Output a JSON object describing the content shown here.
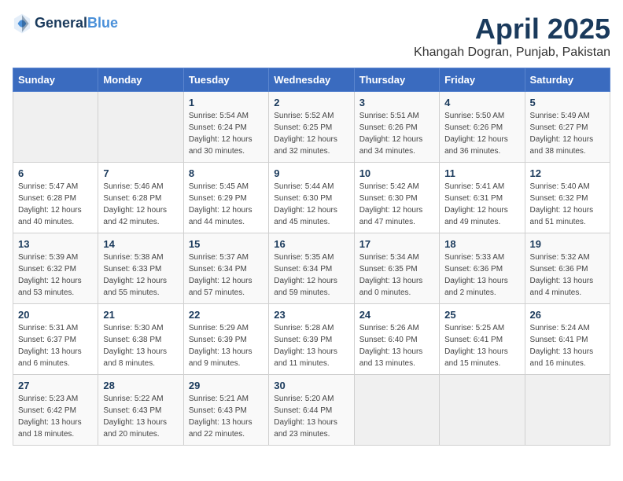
{
  "header": {
    "logo_line1": "General",
    "logo_line2": "Blue",
    "title": "April 2025",
    "subtitle": "Khangah Dogran, Punjab, Pakistan"
  },
  "weekdays": [
    "Sunday",
    "Monday",
    "Tuesday",
    "Wednesday",
    "Thursday",
    "Friday",
    "Saturday"
  ],
  "weeks": [
    [
      {
        "empty": true
      },
      {
        "empty": true
      },
      {
        "day": "1",
        "sunrise": "5:54 AM",
        "sunset": "6:24 PM",
        "daylight": "12 hours and 30 minutes."
      },
      {
        "day": "2",
        "sunrise": "5:52 AM",
        "sunset": "6:25 PM",
        "daylight": "12 hours and 32 minutes."
      },
      {
        "day": "3",
        "sunrise": "5:51 AM",
        "sunset": "6:26 PM",
        "daylight": "12 hours and 34 minutes."
      },
      {
        "day": "4",
        "sunrise": "5:50 AM",
        "sunset": "6:26 PM",
        "daylight": "12 hours and 36 minutes."
      },
      {
        "day": "5",
        "sunrise": "5:49 AM",
        "sunset": "6:27 PM",
        "daylight": "12 hours and 38 minutes."
      }
    ],
    [
      {
        "day": "6",
        "sunrise": "5:47 AM",
        "sunset": "6:28 PM",
        "daylight": "12 hours and 40 minutes."
      },
      {
        "day": "7",
        "sunrise": "5:46 AM",
        "sunset": "6:28 PM",
        "daylight": "12 hours and 42 minutes."
      },
      {
        "day": "8",
        "sunrise": "5:45 AM",
        "sunset": "6:29 PM",
        "daylight": "12 hours and 44 minutes."
      },
      {
        "day": "9",
        "sunrise": "5:44 AM",
        "sunset": "6:30 PM",
        "daylight": "12 hours and 45 minutes."
      },
      {
        "day": "10",
        "sunrise": "5:42 AM",
        "sunset": "6:30 PM",
        "daylight": "12 hours and 47 minutes."
      },
      {
        "day": "11",
        "sunrise": "5:41 AM",
        "sunset": "6:31 PM",
        "daylight": "12 hours and 49 minutes."
      },
      {
        "day": "12",
        "sunrise": "5:40 AM",
        "sunset": "6:32 PM",
        "daylight": "12 hours and 51 minutes."
      }
    ],
    [
      {
        "day": "13",
        "sunrise": "5:39 AM",
        "sunset": "6:32 PM",
        "daylight": "12 hours and 53 minutes."
      },
      {
        "day": "14",
        "sunrise": "5:38 AM",
        "sunset": "6:33 PM",
        "daylight": "12 hours and 55 minutes."
      },
      {
        "day": "15",
        "sunrise": "5:37 AM",
        "sunset": "6:34 PM",
        "daylight": "12 hours and 57 minutes."
      },
      {
        "day": "16",
        "sunrise": "5:35 AM",
        "sunset": "6:34 PM",
        "daylight": "12 hours and 59 minutes."
      },
      {
        "day": "17",
        "sunrise": "5:34 AM",
        "sunset": "6:35 PM",
        "daylight": "13 hours and 0 minutes."
      },
      {
        "day": "18",
        "sunrise": "5:33 AM",
        "sunset": "6:36 PM",
        "daylight": "13 hours and 2 minutes."
      },
      {
        "day": "19",
        "sunrise": "5:32 AM",
        "sunset": "6:36 PM",
        "daylight": "13 hours and 4 minutes."
      }
    ],
    [
      {
        "day": "20",
        "sunrise": "5:31 AM",
        "sunset": "6:37 PM",
        "daylight": "13 hours and 6 minutes."
      },
      {
        "day": "21",
        "sunrise": "5:30 AM",
        "sunset": "6:38 PM",
        "daylight": "13 hours and 8 minutes."
      },
      {
        "day": "22",
        "sunrise": "5:29 AM",
        "sunset": "6:39 PM",
        "daylight": "13 hours and 9 minutes."
      },
      {
        "day": "23",
        "sunrise": "5:28 AM",
        "sunset": "6:39 PM",
        "daylight": "13 hours and 11 minutes."
      },
      {
        "day": "24",
        "sunrise": "5:26 AM",
        "sunset": "6:40 PM",
        "daylight": "13 hours and 13 minutes."
      },
      {
        "day": "25",
        "sunrise": "5:25 AM",
        "sunset": "6:41 PM",
        "daylight": "13 hours and 15 minutes."
      },
      {
        "day": "26",
        "sunrise": "5:24 AM",
        "sunset": "6:41 PM",
        "daylight": "13 hours and 16 minutes."
      }
    ],
    [
      {
        "day": "27",
        "sunrise": "5:23 AM",
        "sunset": "6:42 PM",
        "daylight": "13 hours and 18 minutes."
      },
      {
        "day": "28",
        "sunrise": "5:22 AM",
        "sunset": "6:43 PM",
        "daylight": "13 hours and 20 minutes."
      },
      {
        "day": "29",
        "sunrise": "5:21 AM",
        "sunset": "6:43 PM",
        "daylight": "13 hours and 22 minutes."
      },
      {
        "day": "30",
        "sunrise": "5:20 AM",
        "sunset": "6:44 PM",
        "daylight": "13 hours and 23 minutes."
      },
      {
        "empty": true
      },
      {
        "empty": true
      },
      {
        "empty": true
      }
    ]
  ],
  "labels": {
    "sunrise_prefix": "Sunrise: ",
    "sunset_prefix": "Sunset: ",
    "daylight_prefix": "Daylight: "
  }
}
